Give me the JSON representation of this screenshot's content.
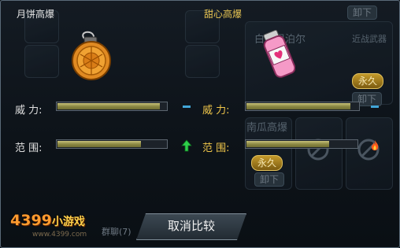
{
  "left_item": {
    "title": "月饼高爆",
    "stats": [
      {
        "label": "威  力:",
        "value": 0.94
      },
      {
        "label": "范  围:",
        "value": 0.77
      }
    ]
  },
  "right_item": {
    "title": "甜心高爆",
    "stats": [
      {
        "label": "威  力:",
        "value": 0.93
      },
      {
        "label": "范  围:",
        "value": 0.75
      }
    ],
    "compare_indicators": [
      "dash",
      "up-arrow"
    ]
  },
  "background": {
    "weapon_name": "白金尼泊尔",
    "weapon_type": "近战武器",
    "second_name": "南瓜高爆",
    "permanent_label": "永久",
    "unequip_label": "卸下",
    "chat_label": "群聊(7)"
  },
  "buttons": {
    "cancel_compare": "取消比较"
  },
  "logo": {
    "main": "4399",
    "sub": "小游戏",
    "url": "www.4399.com"
  },
  "colors": {
    "accent_gold": "#f0c64a",
    "bar_fill": "#c8c27a",
    "dash_blue": "#42a6d8",
    "arrow_green": "#2ecf4a"
  }
}
